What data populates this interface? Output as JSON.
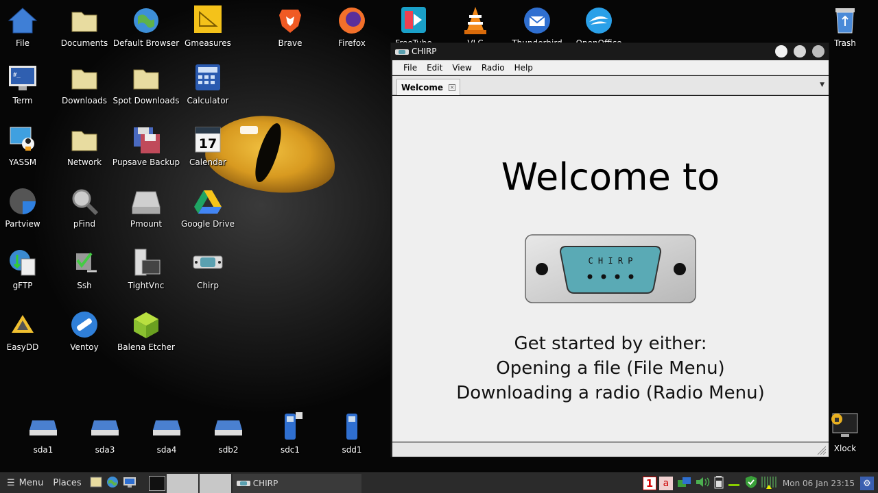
{
  "desktop": {
    "icons": [
      {
        "label": "File",
        "icon": "home-folder-icon"
      },
      {
        "label": "Documents",
        "icon": "folder-icon"
      },
      {
        "label": "Default Browser",
        "icon": "globe-icon"
      },
      {
        "label": "Gmeasures",
        "icon": "ruler-icon"
      },
      {
        "label": "Brave",
        "icon": "brave-icon"
      },
      {
        "label": "Firefox",
        "icon": "firefox-icon"
      },
      {
        "label": "FreeTube",
        "icon": "freetube-icon"
      },
      {
        "label": "VLC",
        "icon": "vlc-icon"
      },
      {
        "label": "Thunderbird",
        "icon": "thunderbird-icon"
      },
      {
        "label": "OpenOffice",
        "icon": "openoffice-icon"
      },
      {
        "label": "Trash",
        "icon": "trash-icon"
      },
      {
        "label": "Term",
        "icon": "terminal-icon"
      },
      {
        "label": "Downloads",
        "icon": "folder-icon"
      },
      {
        "label": "Spot Downloads",
        "icon": "folder-icon"
      },
      {
        "label": "Calculator",
        "icon": "calculator-icon"
      },
      {
        "label": "YASSM",
        "icon": "yassm-icon"
      },
      {
        "label": "Network",
        "icon": "folder-icon"
      },
      {
        "label": "Pupsave Backup",
        "icon": "floppy-icon"
      },
      {
        "label": "Calendar",
        "icon": "calendar-icon",
        "glyph": "17"
      },
      {
        "label": "Partview",
        "icon": "pie-icon"
      },
      {
        "label": "pFind",
        "icon": "magnifier-icon"
      },
      {
        "label": "Pmount",
        "icon": "drive-icon"
      },
      {
        "label": "Google Drive",
        "icon": "google-drive-icon"
      },
      {
        "label": "gFTP",
        "icon": "gftp-icon"
      },
      {
        "label": "Ssh",
        "icon": "ssh-icon"
      },
      {
        "label": "TightVnc",
        "icon": "vnc-icon"
      },
      {
        "label": "Chirp",
        "icon": "serial-port-icon"
      },
      {
        "label": "EasyDD",
        "icon": "easydd-icon"
      },
      {
        "label": "Ventoy",
        "icon": "ventoy-icon"
      },
      {
        "label": "Balena Etcher",
        "icon": "cube-icon"
      },
      {
        "label": "sda1",
        "icon": "hdd-icon"
      },
      {
        "label": "sda3",
        "icon": "hdd-icon"
      },
      {
        "label": "sda4",
        "icon": "hdd-icon"
      },
      {
        "label": "sdb2",
        "icon": "hdd-icon"
      },
      {
        "label": "sdc1",
        "icon": "usb-drive-icon"
      },
      {
        "label": "sdd1",
        "icon": "usb-drive-icon"
      },
      {
        "label": "Xlock",
        "icon": "lock-screen-icon"
      }
    ]
  },
  "window": {
    "title": "CHIRP",
    "menu": [
      "File",
      "Edit",
      "View",
      "Radio",
      "Help"
    ],
    "tab": {
      "label": "Welcome",
      "close": "×"
    },
    "welcome": "Welcome to",
    "logo_text": "C H I R P",
    "lines": [
      "Get started by either:",
      "Opening a file (File Menu)",
      "Downloading a radio (Radio Menu)"
    ],
    "buttons_colors": [
      "#f2f2f2",
      "#d8d8d8",
      "#bdbdbd"
    ]
  },
  "taskbar": {
    "menu_label": "Menu",
    "places_label": "Places",
    "task_label": "CHIRP",
    "workspace": "1",
    "clock": "Mon 06 Jan 23:15",
    "tray_letter": "a"
  }
}
